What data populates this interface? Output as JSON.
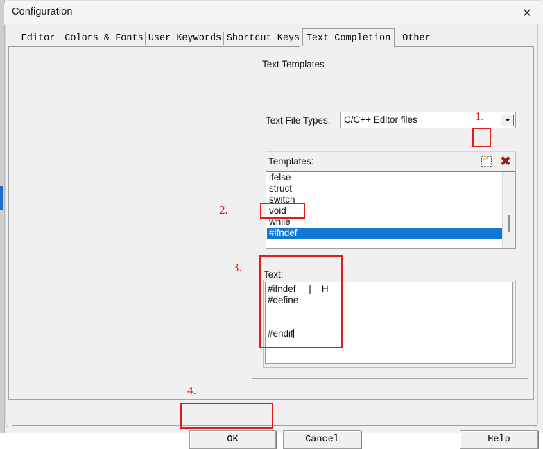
{
  "window": {
    "title": "Configuration",
    "close_icon": "close-icon"
  },
  "tabs": [
    {
      "label": "Editor",
      "active": false
    },
    {
      "label": "Colors & Fonts",
      "active": false
    },
    {
      "label": "User Keywords",
      "active": false
    },
    {
      "label": "Shortcut Keys",
      "active": false
    },
    {
      "label": "Text Completion",
      "active": true
    },
    {
      "label": "Other",
      "active": false
    }
  ],
  "group": {
    "title": "Text Templates"
  },
  "file_types": {
    "label": "Text File Types:",
    "value": "C/C++ Editor files",
    "arrow_icon": "chevron-down-icon"
  },
  "templates": {
    "label": "Templates:",
    "new_icon": "new-template-icon",
    "delete_icon": "delete-x-icon",
    "items": [
      {
        "label": "ifelse",
        "selected": false
      },
      {
        "label": "struct",
        "selected": false
      },
      {
        "label": "switch",
        "selected": false
      },
      {
        "label": "void",
        "selected": false
      },
      {
        "label": "while",
        "selected": false
      },
      {
        "label": "#ifndef",
        "selected": true
      }
    ]
  },
  "text_editor": {
    "label": "Text:",
    "lines": [
      "#ifndef __|__H__",
      "#define",
      "",
      "",
      "#endif"
    ]
  },
  "buttons": {
    "ok": "OK",
    "cancel": "Cancel",
    "help": "Help"
  },
  "annotations": [
    {
      "number": "1."
    },
    {
      "number": "2."
    },
    {
      "number": "3."
    },
    {
      "number": "4."
    }
  ],
  "colors": {
    "selection_blue": "#1277d4",
    "annotation_red": "#e01b1b",
    "delete_x_red": "#9e1b1b",
    "dialog_face": "#f0f0f0"
  }
}
